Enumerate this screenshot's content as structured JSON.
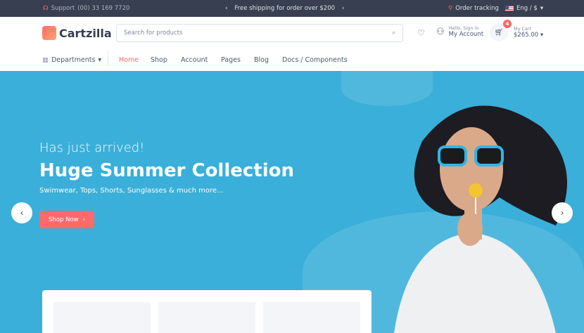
{
  "topbar": {
    "support_label": "Support",
    "phone": "(00) 33 169 7720",
    "promo": "Free shipping for order over $200",
    "order_tracking": "Order tracking",
    "language": "Eng / $"
  },
  "header": {
    "brand": "Cartzilla",
    "search_placeholder": "Search for products",
    "account_greeting": "Hello, Sign in",
    "account_label": "My Account",
    "cart_label": "My Cart",
    "cart_total": "$265.00",
    "cart_count": "4"
  },
  "nav": {
    "departments": "Departments",
    "items": [
      "Home",
      "Shop",
      "Account",
      "Pages",
      "Blog",
      "Docs / Components"
    ],
    "active": "Home"
  },
  "hero": {
    "subtitle": "Has just arrived!",
    "title": "Huge Summer Collection",
    "description": "Swimwear, Tops, Shorts, Sunglasses & much more...",
    "cta": "Shop Now"
  },
  "colors": {
    "accent": "#fe696a",
    "hero_bg": "#3aafd9",
    "topbar_bg": "#373f50"
  }
}
